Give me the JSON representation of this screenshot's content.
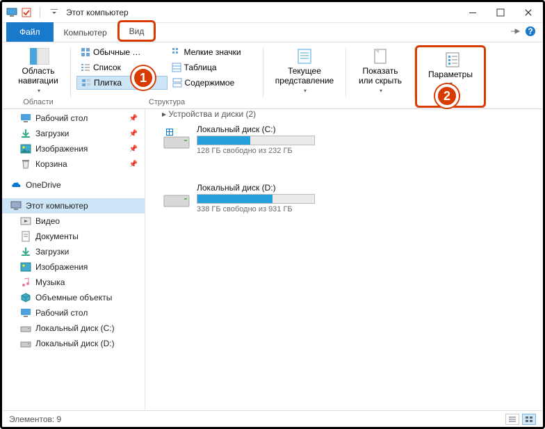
{
  "titlebar": {
    "title": "Этот компьютер"
  },
  "tabs": {
    "file": "Файл",
    "computer": "Компьютер",
    "view": "Вид"
  },
  "ribbon": {
    "nav_pane": "Область навигации",
    "nav_group": "Области",
    "layout": {
      "l1": "Обычные …",
      "l2": "Мелкие значки",
      "l3": "Список",
      "l4": "Таблица",
      "l5": "Плитка",
      "l6": "Содержимое",
      "group": "Структура"
    },
    "current_view": "Текущее представление",
    "show_hide": "Показать или скрыть",
    "options": "Параметры"
  },
  "badges": {
    "one": "1",
    "two": "2"
  },
  "nav": {
    "desktop": "Рабочий стол",
    "downloads": "Загрузки",
    "pictures": "Изображения",
    "recycle": "Корзина",
    "onedrive": "OneDrive",
    "this_pc": "Этот компьютер",
    "videos": "Видео",
    "documents": "Документы",
    "downloads2": "Загрузки",
    "pictures2": "Изображения",
    "music": "Музыка",
    "objects3d": "Объемные объекты",
    "desktop2": "Рабочий стол",
    "disk_c": "Локальный диск (C:)",
    "disk_d": "Локальный диск (D:)"
  },
  "content": {
    "section": "Устройства и диски (2)",
    "drives": [
      {
        "name": "Локальный диск (C:)",
        "free": "128 ГБ свободно из 232 ГБ",
        "fill_pct": 45
      },
      {
        "name": "Локальный диск (D:)",
        "free": "338 ГБ свободно из 931 ГБ",
        "fill_pct": 64
      }
    ]
  },
  "status": {
    "count": "Элементов: 9"
  },
  "colors": {
    "accent": "#26A0DA",
    "highlight": "#D83B01"
  }
}
